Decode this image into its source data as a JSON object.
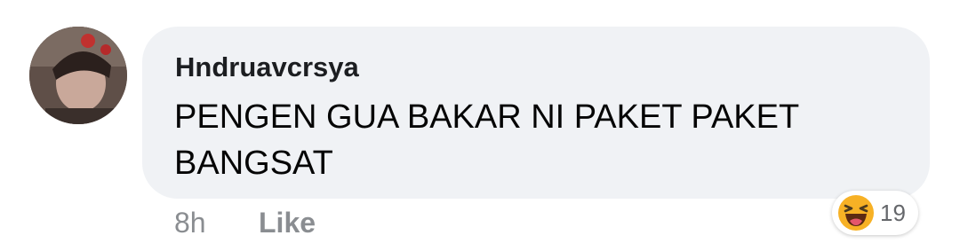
{
  "comment": {
    "author": "Hndruavcrsya",
    "text": "PENGEN GUA BAKAR NI PAKET PAKET BANGSAT",
    "avatar_icon": "profile-photo"
  },
  "meta": {
    "time": "8h",
    "like_label": "Like"
  },
  "reactions": {
    "icon": "haha-emoji",
    "count": "19"
  },
  "colors": {
    "bubble": "#f0f2f5",
    "meta_text": "#8a8d91",
    "emoji_yellow": "#f7b125"
  }
}
